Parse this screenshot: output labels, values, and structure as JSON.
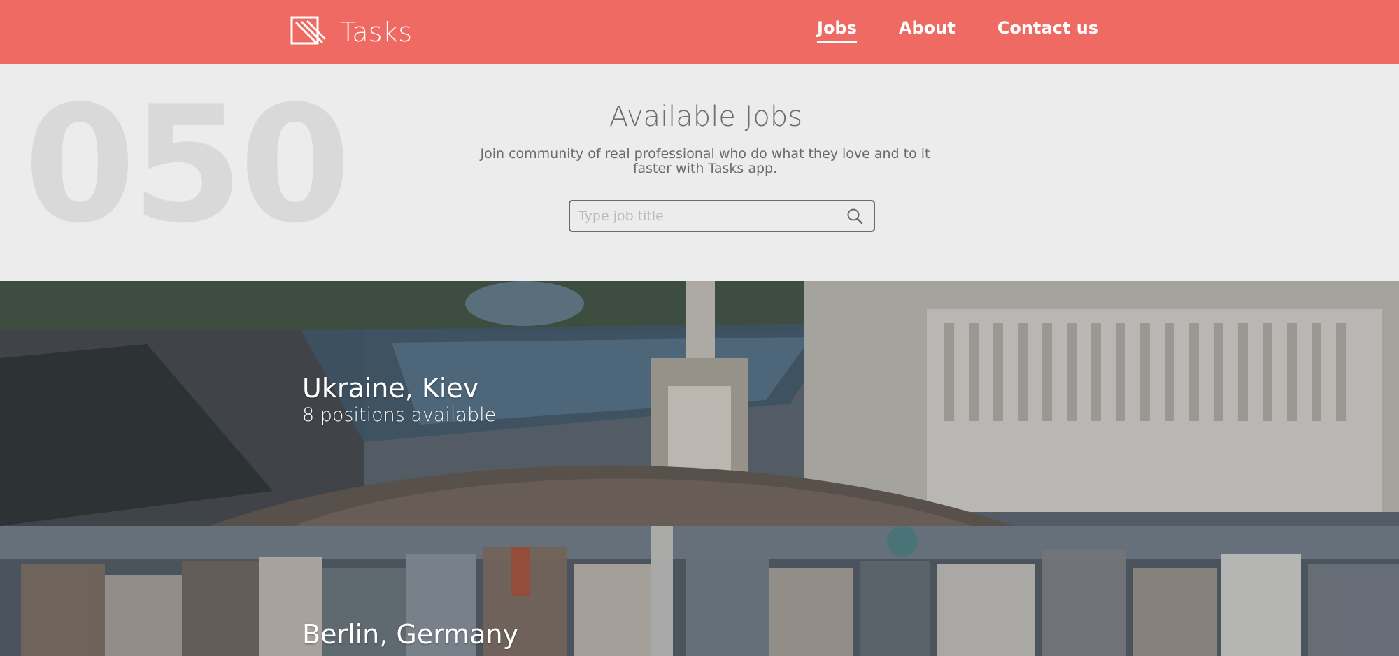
{
  "header": {
    "brand": {
      "name": "Tasks",
      "icon": "tasks-logo-icon"
    },
    "nav": [
      {
        "label": "Jobs",
        "active": true
      },
      {
        "label": "About",
        "active": false
      },
      {
        "label": "Contact us",
        "active": false
      }
    ],
    "accent_color": "#ee6a62"
  },
  "hero": {
    "background_number": "050",
    "title": "Available Jobs",
    "subtitle": "Join community of real professional who do what they love and to it faster with Tasks app.",
    "search": {
      "placeholder": "Type job title",
      "value": "",
      "icon": "search-icon"
    }
  },
  "locations": [
    {
      "city": "Ukraine, Kiev",
      "positions": "8 positions available"
    },
    {
      "city": "Berlin, Germany",
      "positions": ""
    }
  ]
}
